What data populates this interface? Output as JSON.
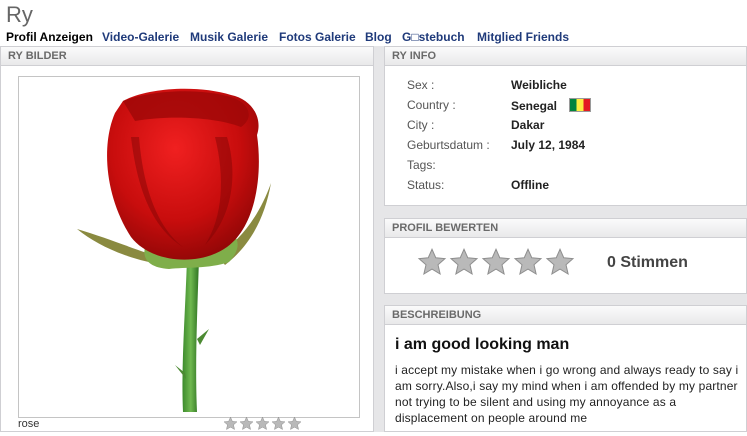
{
  "header": {
    "title": "Ry"
  },
  "nav": {
    "items": [
      {
        "label": "Profil Anzeigen"
      },
      {
        "label": "Video-Galerie"
      },
      {
        "label": "Musik Galerie"
      },
      {
        "label": "Fotos Galerie"
      },
      {
        "label": "Blog"
      },
      {
        "label": "G□stebuch"
      },
      {
        "label": "Mitglied Friends"
      }
    ]
  },
  "photos": {
    "heading": "RY BILDER",
    "caption": "rose",
    "rating_stars": 5,
    "filled_stars": 0
  },
  "info": {
    "heading": "RY INFO",
    "rows": [
      {
        "label": "Sex :",
        "value": "Weibliche"
      },
      {
        "label": "Country :",
        "value": "Senegal"
      },
      {
        "label": "City :",
        "value": "Dakar"
      },
      {
        "label": "Geburtsdatum :",
        "value": "July 12, 1984"
      },
      {
        "label": "Tags:",
        "value": ""
      },
      {
        "label": "Status:",
        "value": "Offline"
      }
    ],
    "flag_colors": [
      "#00853f",
      "#fdef42",
      "#e31b23"
    ]
  },
  "rating": {
    "heading": "PROFIL BEWERTEN",
    "votes_label": "0 Stimmen",
    "stars": 5,
    "filled_stars": 0
  },
  "description": {
    "heading": "BESCHREIBUNG",
    "title": "i am good looking man",
    "text": "i accept my mistake when i go wrong and always ready to say i am sorry.Also,i say my mind when i am offended by my partner not trying to be silent and using my annoyance as a displacement on people around me"
  },
  "colors": {
    "nav_link": "#1f3a7a",
    "panel_background": "#e6e6e8",
    "star_empty": "#b9b9b9"
  }
}
